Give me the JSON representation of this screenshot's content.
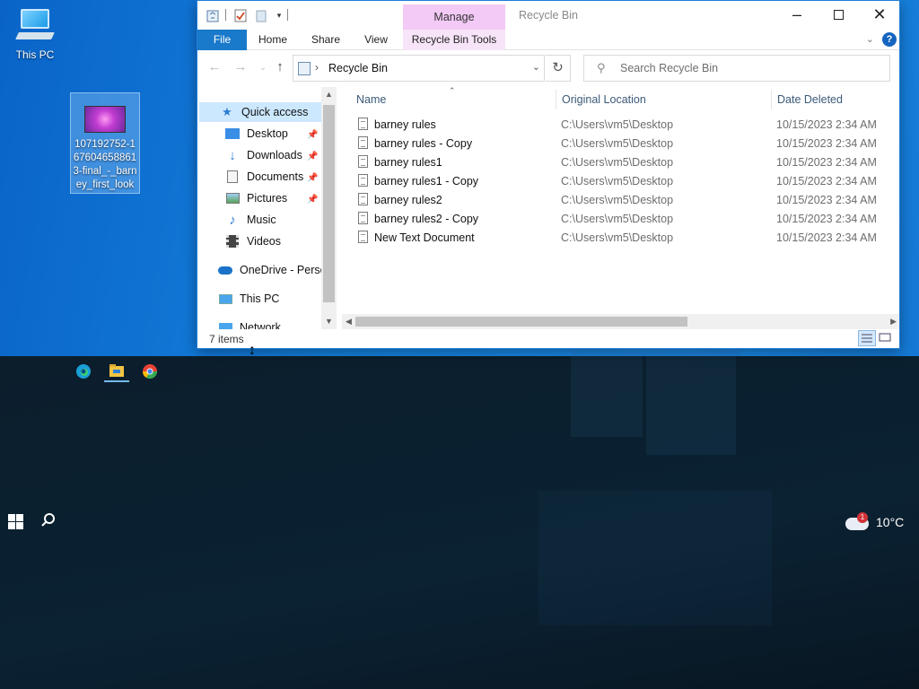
{
  "desktop": {
    "icons": [
      {
        "label": "This PC"
      },
      {
        "label": "107192752-1676046588613-final_-_barney_first_look"
      }
    ]
  },
  "window": {
    "title": "Recycle Bin",
    "manage_tab": "Manage",
    "ribbon": {
      "file": "File",
      "home": "Home",
      "share": "Share",
      "view": "View",
      "tools": "Recycle Bin Tools"
    },
    "address": {
      "path": "Recycle Bin",
      "search_placeholder": "Search Recycle Bin"
    },
    "nav_pane": {
      "items": [
        {
          "label": "Quick access",
          "icon": "star-icon"
        },
        {
          "label": "Desktop",
          "icon": "desktop-folder-icon",
          "pinned": true
        },
        {
          "label": "Downloads",
          "icon": "download-icon",
          "pinned": true
        },
        {
          "label": "Documents",
          "icon": "documents-icon",
          "pinned": true
        },
        {
          "label": "Pictures",
          "icon": "pictures-icon",
          "pinned": true
        },
        {
          "label": "Music",
          "icon": "music-icon"
        },
        {
          "label": "Videos",
          "icon": "videos-icon"
        },
        {
          "label": "OneDrive - Persor",
          "icon": "cloud-icon"
        },
        {
          "label": "This PC",
          "icon": "computer-icon"
        },
        {
          "label": "Network",
          "icon": "network-icon"
        }
      ]
    },
    "columns": {
      "name": "Name",
      "original_location": "Original Location",
      "date_deleted": "Date Deleted"
    },
    "files": [
      {
        "name": "barney rules",
        "location": "C:\\Users\\vm5\\Desktop",
        "date": "10/15/2023 2:34 AM"
      },
      {
        "name": "barney rules - Copy",
        "location": "C:\\Users\\vm5\\Desktop",
        "date": "10/15/2023 2:34 AM"
      },
      {
        "name": "barney rules1",
        "location": "C:\\Users\\vm5\\Desktop",
        "date": "10/15/2023 2:34 AM"
      },
      {
        "name": "barney rules1 - Copy",
        "location": "C:\\Users\\vm5\\Desktop",
        "date": "10/15/2023 2:34 AM"
      },
      {
        "name": "barney rules2",
        "location": "C:\\Users\\vm5\\Desktop",
        "date": "10/15/2023 2:34 AM"
      },
      {
        "name": "barney rules2 - Copy",
        "location": "C:\\Users\\vm5\\Desktop",
        "date": "10/15/2023 2:34 AM"
      },
      {
        "name": "New Text Document",
        "location": "C:\\Users\\vm5\\Desktop",
        "date": "10/15/2023 2:34 AM"
      }
    ],
    "status": "7 items"
  },
  "taskbar": {
    "apps": [
      "edge-icon",
      "file-explorer-icon",
      "chrome-icon"
    ],
    "weather": {
      "temperature": "10°C",
      "badge": "1"
    }
  },
  "colors": {
    "accent": "#1979ca",
    "manage_tab": "#f3c9f6",
    "selection": "#cce8ff"
  }
}
